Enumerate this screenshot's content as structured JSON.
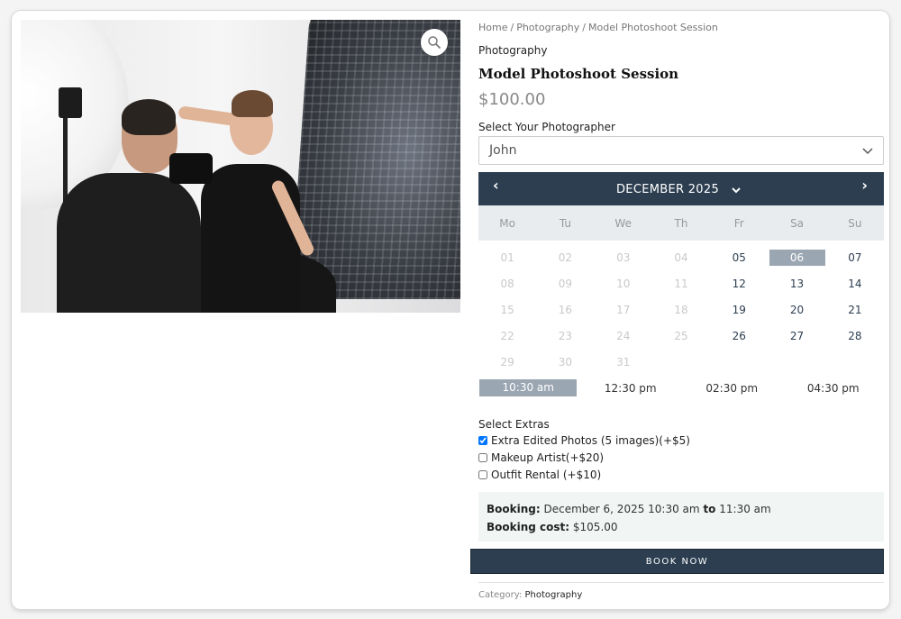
{
  "image": {
    "zoom_icon": "magnifier-icon"
  },
  "breadcrumb": {
    "items": [
      "Home",
      "Photography",
      "Model Photoshoot Session"
    ],
    "separator": "/"
  },
  "product": {
    "category": "Photography",
    "title": "Model Photoshoot Session",
    "price": "$100.00"
  },
  "photographer": {
    "label": "Select Your Photographer",
    "selected": "John"
  },
  "calendar": {
    "month_label": "DECEMBER 2025",
    "prev": "‹",
    "next": "›",
    "weekdays": [
      "Mo",
      "Tu",
      "We",
      "Th",
      "Fr",
      "Sa",
      "Su"
    ],
    "days": [
      {
        "d": "01",
        "state": "disabled"
      },
      {
        "d": "02",
        "state": "disabled"
      },
      {
        "d": "03",
        "state": "disabled"
      },
      {
        "d": "04",
        "state": "disabled"
      },
      {
        "d": "05",
        "state": "available"
      },
      {
        "d": "06",
        "state": "selected"
      },
      {
        "d": "07",
        "state": "available"
      },
      {
        "d": "08",
        "state": "disabled"
      },
      {
        "d": "09",
        "state": "disabled"
      },
      {
        "d": "10",
        "state": "disabled"
      },
      {
        "d": "11",
        "state": "disabled"
      },
      {
        "d": "12",
        "state": "available"
      },
      {
        "d": "13",
        "state": "available"
      },
      {
        "d": "14",
        "state": "available"
      },
      {
        "d": "15",
        "state": "disabled"
      },
      {
        "d": "16",
        "state": "disabled"
      },
      {
        "d": "17",
        "state": "disabled"
      },
      {
        "d": "18",
        "state": "disabled"
      },
      {
        "d": "19",
        "state": "available"
      },
      {
        "d": "20",
        "state": "available"
      },
      {
        "d": "21",
        "state": "available"
      },
      {
        "d": "22",
        "state": "disabled"
      },
      {
        "d": "23",
        "state": "disabled"
      },
      {
        "d": "24",
        "state": "disabled"
      },
      {
        "d": "25",
        "state": "disabled"
      },
      {
        "d": "26",
        "state": "available"
      },
      {
        "d": "27",
        "state": "available"
      },
      {
        "d": "28",
        "state": "available"
      },
      {
        "d": "29",
        "state": "disabled"
      },
      {
        "d": "30",
        "state": "disabled"
      },
      {
        "d": "31",
        "state": "disabled"
      }
    ]
  },
  "time_slots": [
    {
      "label": "10:30 am",
      "selected": true
    },
    {
      "label": "12:30 pm",
      "selected": false
    },
    {
      "label": "02:30 pm",
      "selected": false
    },
    {
      "label": "04:30 pm",
      "selected": false
    }
  ],
  "extras": {
    "label": "Select Extras",
    "items": [
      {
        "label": "Extra Edited Photos (5 images)(+$5)",
        "checked": true
      },
      {
        "label": "Makeup Artist(+$20)",
        "checked": false
      },
      {
        "label": "Outfit Rental (+$10)",
        "checked": false
      }
    ]
  },
  "summary": {
    "booking_label": "Booking:",
    "booking_date": "December 6, 2025 10:30 am",
    "to_word": "to",
    "booking_end": "11:30 am",
    "cost_label": "Booking cost:",
    "cost_value": "$105.00"
  },
  "book_button": "BOOK NOW",
  "meta": {
    "category_label": "Category:",
    "category_value": "Photography"
  },
  "colors": {
    "calendar_header": "#2c3e50",
    "selected_fill": "#9ba6b3",
    "summary_bg": "#f1f6f5"
  }
}
